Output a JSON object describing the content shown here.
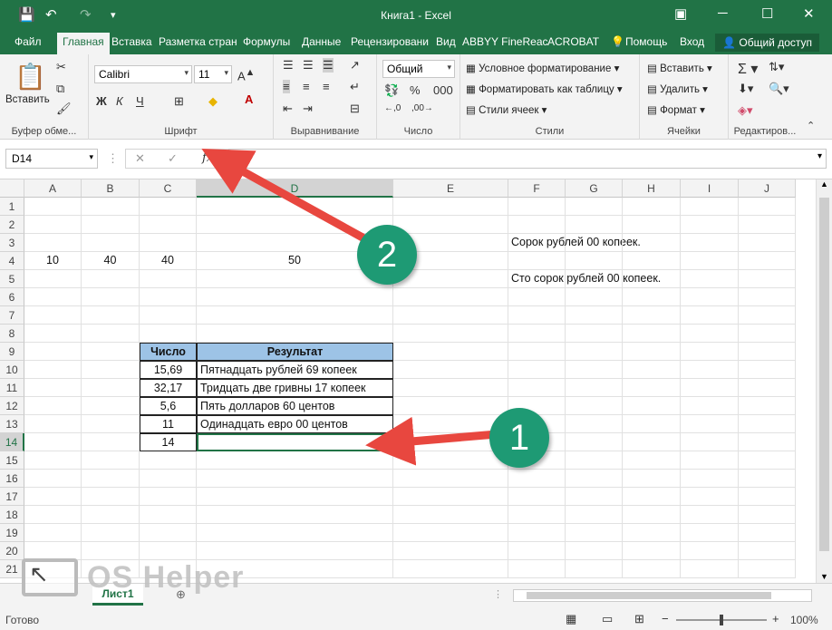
{
  "window": {
    "title": "Книга1 - Excel"
  },
  "ribbon_tabs": [
    "Файл",
    "Главная",
    "Вставка",
    "Разметка стран",
    "Формулы",
    "Данные",
    "Рецензировани",
    "Вид",
    "ABBYY FineReac",
    "ACROBAT",
    "Помощь",
    "Вход"
  ],
  "share_label": "Общий доступ",
  "ribbon": {
    "paste_label": "Вставить",
    "clipboard_group": "Буфер обме...",
    "font_name": "Calibri",
    "font_size": "11",
    "bold": "Ж",
    "italic": "К",
    "underline": "Ч",
    "font_group": "Шрифт",
    "align_group": "Выравнивание",
    "number_format": "Общий",
    "number_group": "Число",
    "cond_format": "Условное форматирование",
    "format_table": "Форматировать как таблицу",
    "cell_styles": "Стили ячеек",
    "styles_group": "Стили",
    "insert": "Вставить",
    "delete": "Удалить",
    "format": "Формат",
    "cells_group": "Ячейки",
    "editing_group": "Редактиров..."
  },
  "formula_bar": {
    "name_box": "D14",
    "fx": "fx",
    "formula": ""
  },
  "columns": [
    "A",
    "B",
    "C",
    "D",
    "E",
    "F",
    "G",
    "H",
    "I",
    "J"
  ],
  "rows": [
    "1",
    "2",
    "3",
    "4",
    "5",
    "6",
    "7",
    "8",
    "9",
    "10",
    "11",
    "12",
    "13",
    "14",
    "15",
    "16",
    "17",
    "18",
    "19",
    "20",
    "21"
  ],
  "cells": {
    "A4": "10",
    "B4": "40",
    "C4": "40",
    "D4": "50",
    "F3": "Сорок рублей  00 копеек.",
    "F5": "Сто сорок рублей  00 копеек.",
    "C9": "Число",
    "D9": "Результат",
    "C10": "15,69",
    "D10": "Пятнадцать рублей 69 копеек",
    "C11": "32,17",
    "D11": "Тридцать две гривны 17 копеек",
    "C12": "5,6",
    "D12": "Пять долларов 60 центов",
    "C13": "11",
    "D13": "Одинадцать евро 00 центов",
    "C14": "14",
    "D14": ""
  },
  "sheet_tab": "Лист1",
  "status": {
    "ready": "Готово",
    "zoom": "100%"
  },
  "badges": {
    "one": "1",
    "two": "2"
  },
  "watermark_text": "OS Helper",
  "colors": {
    "accent": "#217346",
    "header_fill": "#9dc3e6",
    "badge": "#1e9a74",
    "arrow": "#e8473f"
  }
}
